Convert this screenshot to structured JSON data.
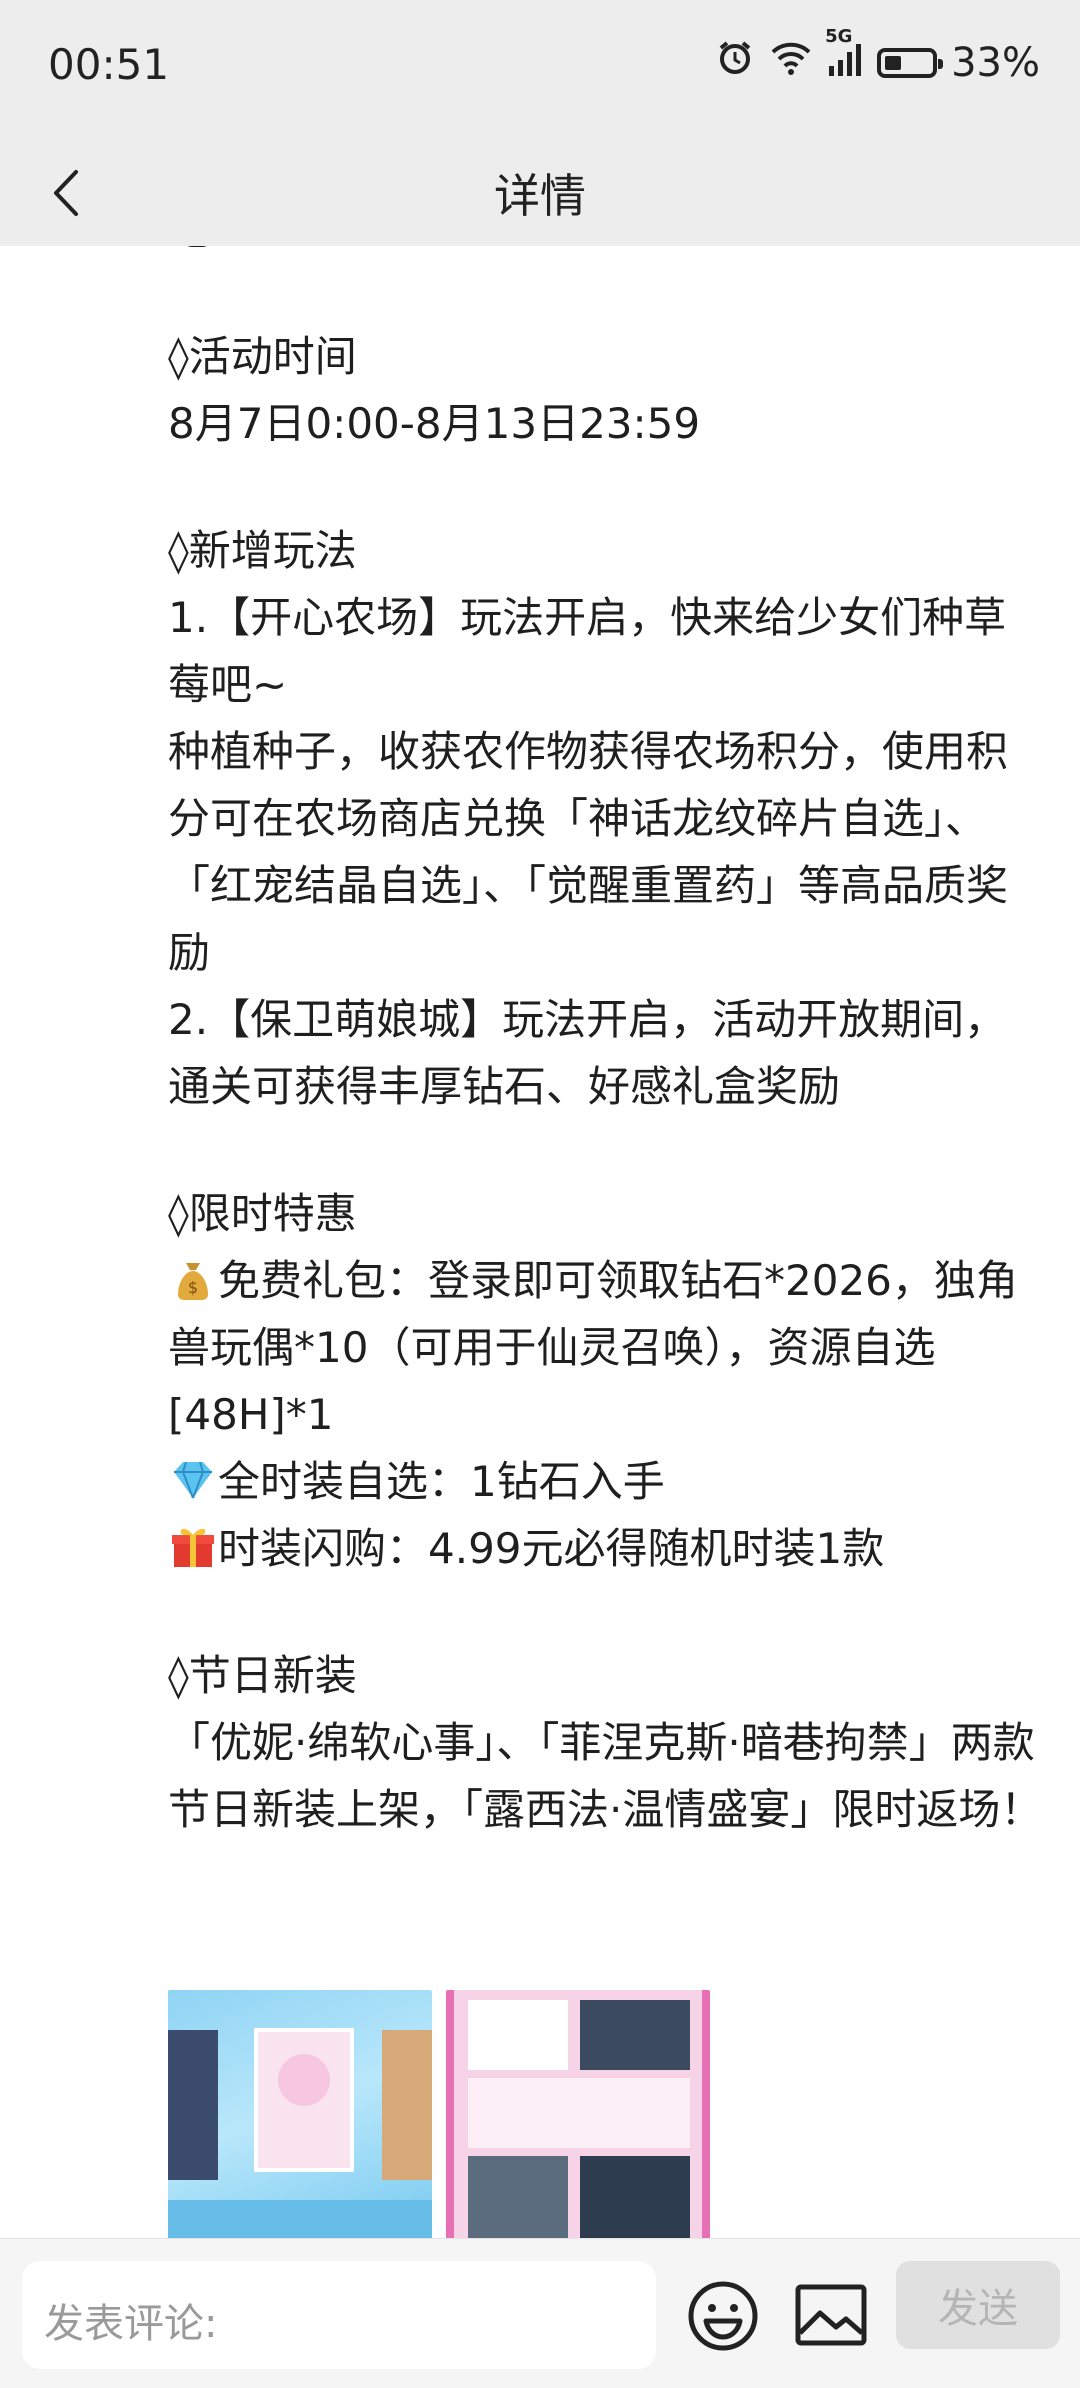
{
  "status_bar": {
    "time": "00:51",
    "network": "5G",
    "battery": "33%"
  },
  "header": {
    "title": "详情"
  },
  "article": {
    "top_line": "吧！",
    "sections": [
      {
        "heading": "◊活动时间",
        "lines": [
          "8月7日0:00-8月13日23:59"
        ]
      },
      {
        "heading": "◊新增玩法",
        "lines": [
          "1.【开心农场】玩法开启，快来给少女们种草莓吧~",
          "种植种子，收获农作物获得农场积分，使用积分可在农场商店兑换「神话龙纹碎片自选」、「红宠结晶自选」、「觉醒重置药」等高品质奖励",
          "2.【保卫萌娘城】玩法开启，活动开放期间，通关可获得丰厚钻石、好感礼盒奖励"
        ]
      },
      {
        "heading": "◊限时特惠",
        "offers": [
          {
            "icon": "money-bag-icon",
            "text": "免费礼包：登录即可领取钻石*2026，独角兽玩偶*10（可用于仙灵召唤），资源自选[48H]*1"
          },
          {
            "icon": "diamond-icon",
            "text": "全时装自选：1钻石入手"
          },
          {
            "icon": "gift-icon",
            "text": "时装闪购：4.99元必得随机时装1款"
          }
        ]
      },
      {
        "heading": "◊节日新装",
        "lines": [
          "「优妮·绵软心事」、「菲涅克斯·暗巷拘禁」两款节日新装上架，「露西法·温情盛宴」限时返场！"
        ]
      }
    ],
    "images": [
      {
        "name": "event-image-1",
        "colors": [
          "#8fd4f3",
          "#70c6ee"
        ]
      },
      {
        "name": "event-image-2",
        "colors": [
          "#f6d3e6",
          "#e66fb6"
        ]
      }
    ]
  },
  "comment_bar": {
    "placeholder": "发表评论:",
    "send_label": "发送",
    "icons": [
      "emoji-icon",
      "image-icon"
    ]
  }
}
